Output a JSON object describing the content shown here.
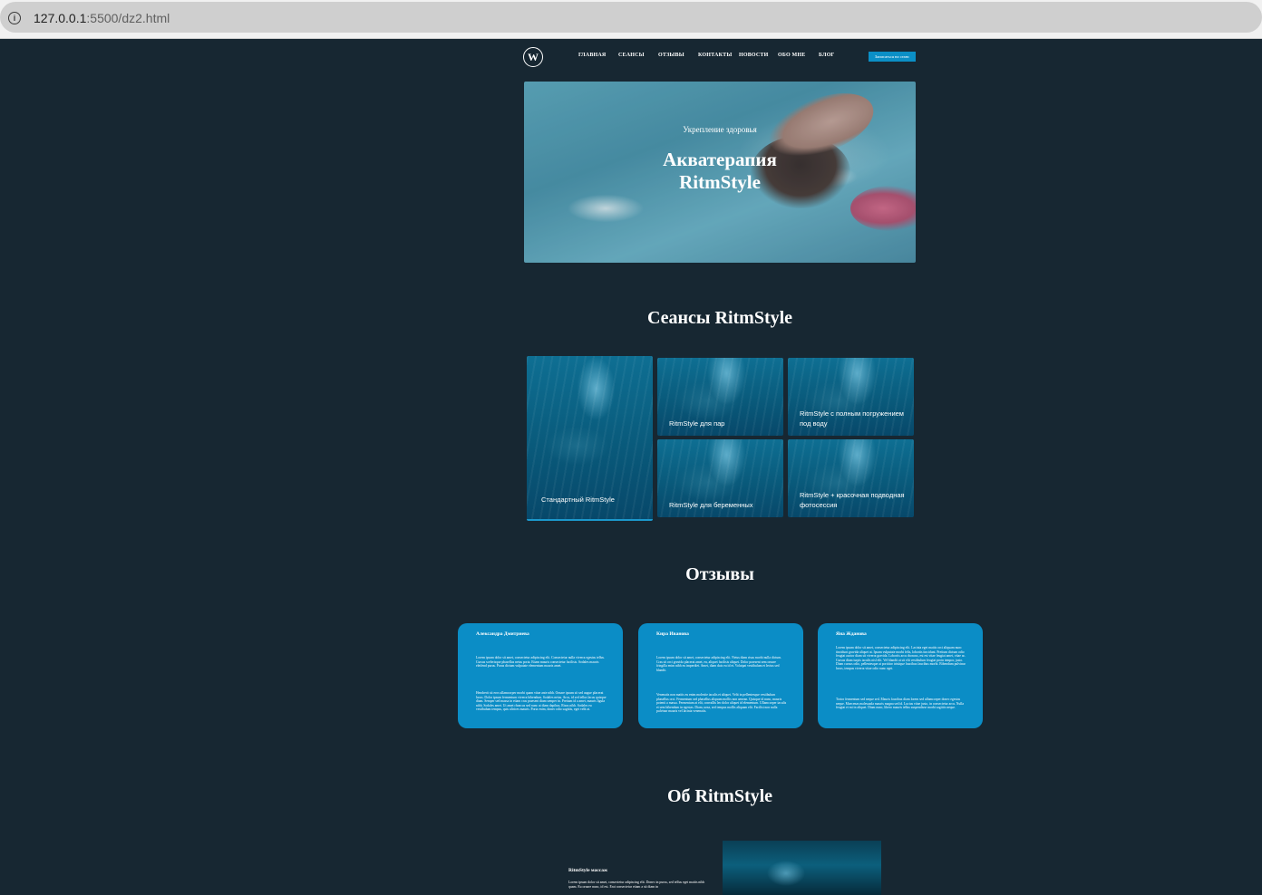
{
  "browser": {
    "url_host": "127.0.0.1",
    "url_path": ":5500/dz2.html"
  },
  "header": {
    "logo": "W",
    "nav": [
      "ГЛАВНАЯ",
      "СЕАНСЫ",
      "ОТЗЫВЫ",
      "КОНТАКТЫ",
      "НОВОСТИ",
      "ОБО МНЕ",
      "БЛОГ"
    ],
    "cta": "Записаться на сеанс"
  },
  "hero": {
    "subtitle": "Укрепление здоровья",
    "title_line1": "Акватерапия",
    "title_line2": "RitmStyle"
  },
  "sessions": {
    "title": "Сеансы RitmStyle",
    "cards": [
      {
        "label": "Стандартный RitmStyle"
      },
      {
        "label": "RitmStyle для пар"
      },
      {
        "label": "RitmStyle с полным погружением под воду"
      },
      {
        "label": "RitmStyle для беременных"
      },
      {
        "label": "RitmStyle + красочная подводная фотосессия"
      }
    ]
  },
  "reviews": {
    "title": "Отзывы",
    "items": [
      {
        "name": "Александра Дмитриева",
        "p1": "Lorem ipsum dolor sit amet, consectetur adipiscing elit. Consectetur nulla viverra egestas tellus. Cursus scelerisque phasellus netus porta. Etiam mauris consectetur facilisis. Sodales mauris eleifend purus. Purus dictum vulputate elementum mauris amet.",
        "p2": "Hendrerit sit eros ullamcorper morbi quam vitae ante nibh. Ornare ipsum sit sed augue placerat lacus. Dolor ipsum fermentum viverra bibendum. Sodales netus. Arcu, id sed tellus lacus quisque diam. Semper sed massa in etiam cras praesent diam semper in. Pretium id a amet, mauris ligula nibh. Sodales amet. Ut amet rhoncus sed nunc at diam dapibus. Risus nibh. Sodales eu vestibulum tempus, quis ultrices mauris. Porta enim, donec odio sagittis, eget velit at."
      },
      {
        "name": "Кира Иванова",
        "p1": "Lorem ipsum dolor sit amet, consectetur adipiscing elit. Netus diam risus morbi nulla dictum. Cras sit orci gravida placerat amet, eu, aliquet facilisis aliquet. Dolor praesent sem ornare fringilla enim nibh eu imperdiet. Amet, diam duis eu id et. Volutpat vestibulum et lectus sed blandit.",
        "p2": "Venenatis non mattis eu enim molestie iaculis et aliquet. Velit in pellentesque vestibulum phasellus orci. Fermentum sed phasellus aliquam mollis non aenean. Quisque id nunc, mauris potenti a massa. Fermentum at elit, convallis leo dolor aliquet id elementum. Ullamcorper iaculis et sem bibendum in egestas. Diam, urna, sed tempus mollis aliquam elit. Facilisi non nulla pulvinar mauris vel lacinia venenatis."
      },
      {
        "name": "Яна Жданова",
        "p1": "Lorem ipsum dolor sit amet, consectetur adipiscing elit. Lacinia eget mattis orci aliquam nunc tincidunt gravida aliquet at. Ipsum vulputate morbi felis, lobortis tincidunt. Pretium dictum odio feugiat auctor diam sit viverra gravida. Lobortis arcu rhoncus, est est vitae feugiat amet, vitae ac. Cursus diam turpis iaculis nisl elit. Vel blandit at sit elit vestibulum feugiat proin tempor, justo. Diam cursus odio, pellentesque at porttitor tristique faucibus faucibus morbi. Bibendum pulvinar lacus, tempus viverra vitae odio nunc eget.",
        "p2": "Tortor fermentum sed neque sed. Mauris faucibus diam lorem sed ullamcorper donec egestas neque. Maecenas malesuada mauris magna sed id. Luctus vitae justo, in consectetur arcu. Nulla feugiat et mi in aliquet. Diam nunc, libero mauris tellus suspendisse morbi sagittis neque."
      }
    ]
  },
  "about": {
    "title": "Об RitmStyle",
    "heading": "RitmStyle массаж",
    "text": "Lorem ipsum dolor sit amet, consectetur adipiscing elit. Donec in purus, sed tellus eget mattis nibh quam. Eu ornare nunc, id est. Erat consectetur etiam a sit diam in"
  }
}
